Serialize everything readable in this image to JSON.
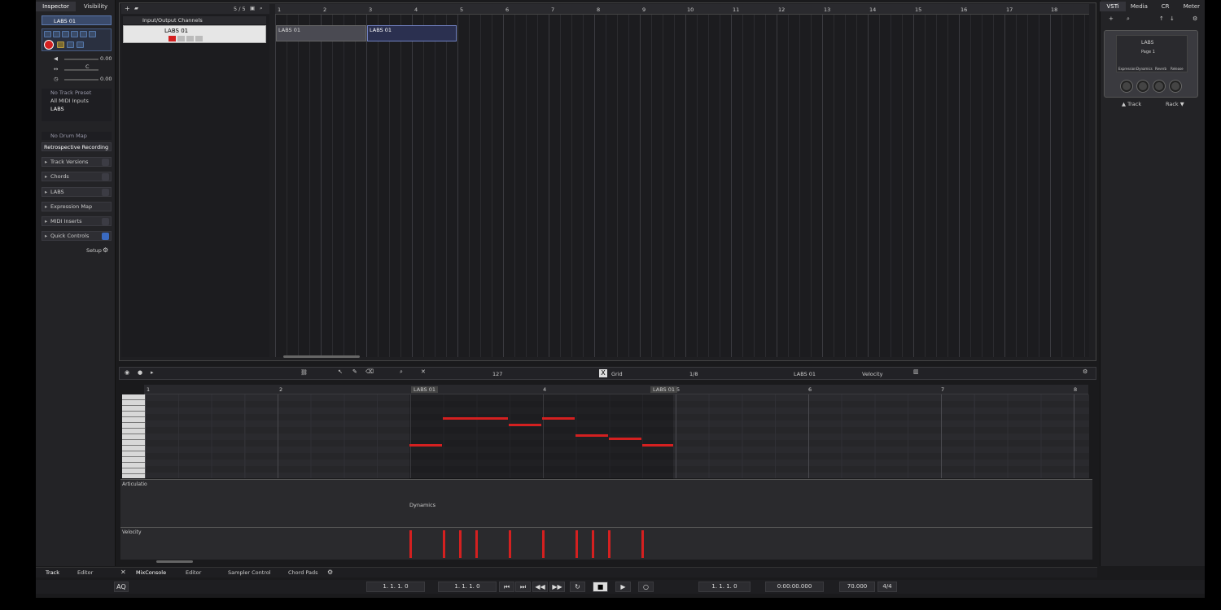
{
  "inspector": {
    "tabs": [
      "Inspector",
      "Visibility"
    ],
    "track_name": "LABS 01",
    "volume": "0.00",
    "pan": "C",
    "delay": "0.00",
    "track_preset": "No Track Preset",
    "midi_input": "All MIDI Inputs",
    "output": "LABS",
    "channel": "1",
    "drum_map": "No Drum Map",
    "retro_recording": "Retrospective Recording",
    "sections": [
      "Track Versions",
      "Chords",
      "LABS",
      "Expression Map",
      "MIDI Inserts",
      "Quick Controls"
    ],
    "setup": "Setup"
  },
  "project": {
    "counter": "5 / 5",
    "folder_label": "Input/Output Channels",
    "track_name": "LABS 01",
    "ruler": [
      "1",
      "2",
      "3",
      "4",
      "5",
      "6",
      "7",
      "8",
      "9",
      "10",
      "11",
      "12",
      "13",
      "14",
      "15",
      "16",
      "17",
      "18"
    ],
    "part1_label": "LABS 01",
    "part2_label": "LABS 01"
  },
  "editor": {
    "velocity_value": "127",
    "grid_label": "Grid",
    "quantize": "1/8",
    "part_select": "LABS 01",
    "lane_select": "Velocity",
    "ruler": [
      "1",
      "2",
      "4",
      "5",
      "6",
      "7",
      "8"
    ],
    "part_label_left": "LABS 01",
    "part_label_right": "LABS 01",
    "articulation_label": "Articulatio",
    "dynamics_label": "Dynamics",
    "velocity_label": "Velocity"
  },
  "zones": {
    "left_tabs": [
      "Track",
      "Editor"
    ],
    "bottom_tabs": [
      "MixConsole",
      "Editor",
      "Sampler Control",
      "Chord Pads"
    ]
  },
  "transport": {
    "left_locator": "1. 1. 1.  0",
    "right_locator": "1. 1. 1.  0",
    "position": "1. 1. 1.  0",
    "time": "0:00:00.000",
    "tempo": "70.000",
    "signature": "4/4",
    "aq": "AQ"
  },
  "rack": {
    "tabs": [
      "VSTi",
      "Media",
      "CR",
      "Meter"
    ],
    "instrument": "LABS",
    "page": "Page 1",
    "qc_labels": [
      "Expression",
      "Dynamics",
      "Reverb",
      "Release"
    ],
    "track_btn": "Track",
    "rack_btn": "Rack"
  },
  "colors": {
    "accent": "#d42020",
    "selected_part": "#2b3050",
    "bg": "#1a1a1c"
  }
}
